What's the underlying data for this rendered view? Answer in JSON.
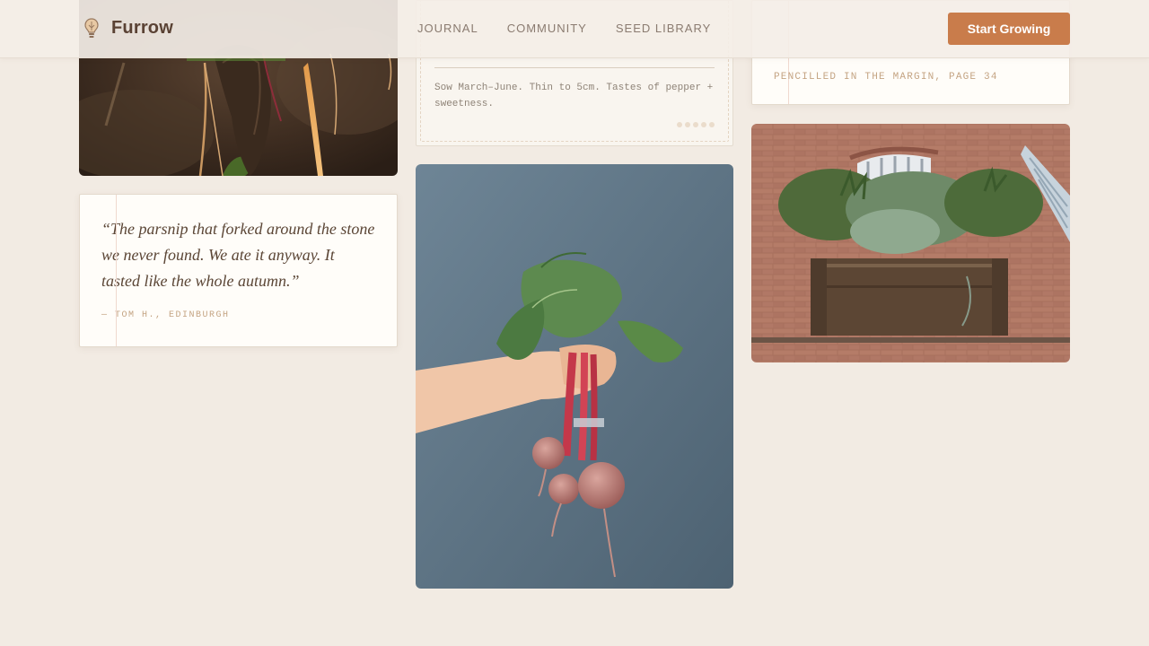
{
  "nav": {
    "brand": "Furrow",
    "links": [
      "JOURNAL",
      "COMMUNITY",
      "SEED LIBRARY"
    ],
    "cta": "Start Growing"
  },
  "quote": {
    "text": "“The parsnip that forked around the stone we never found. We ate it anyway. It tasted like the whole autumn.”",
    "author": "— TOM H., EDINBURGH"
  },
  "note": {
    "text": "Sow March–June. Thin to 5cm. Tastes of pepper + sweetness."
  },
  "margin_note": {
    "caption": "PENCILLED IN THE MARGIN, PAGE 34"
  },
  "colors": {
    "background": "#f2ebe3",
    "accent": "#c97c4b",
    "text": "#5b4636",
    "muted": "#8a7b70"
  },
  "icons": {
    "brand": "seed-bulb-icon"
  }
}
